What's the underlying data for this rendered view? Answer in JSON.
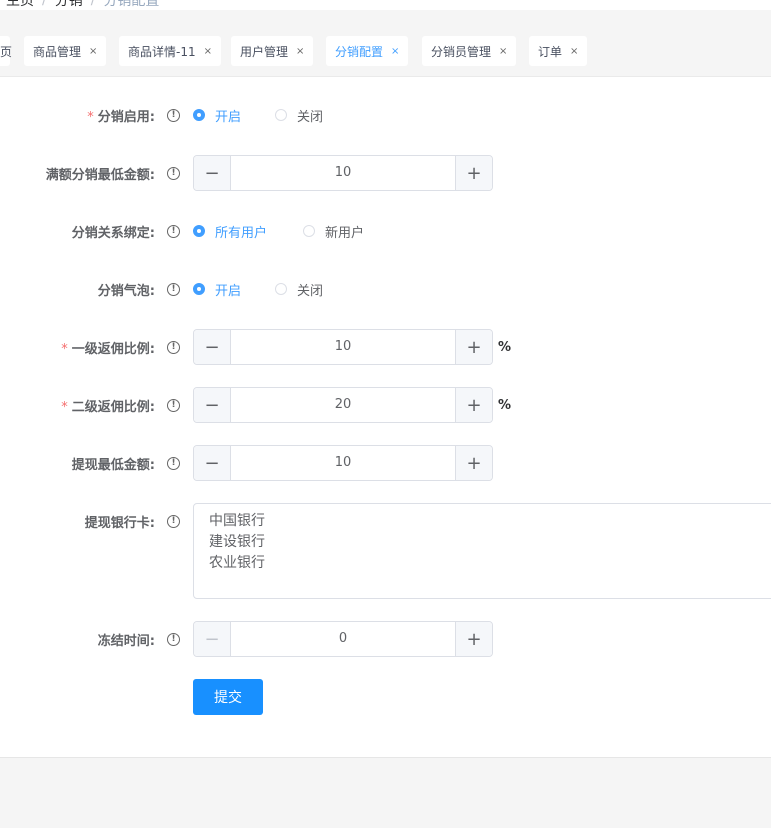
{
  "breadcrumb": {
    "items": [
      "主页",
      "分销",
      "分销配置"
    ],
    "separator": "/"
  },
  "tags": [
    {
      "label": "页",
      "closable": false
    },
    {
      "label": "商品管理",
      "closable": true
    },
    {
      "label": "商品详情-11",
      "closable": true
    },
    {
      "label": "用户管理",
      "closable": true
    },
    {
      "label": "分销配置",
      "closable": true,
      "active": true
    },
    {
      "label": "分销员管理",
      "closable": true
    },
    {
      "label": "订单",
      "closable": true
    }
  ],
  "close_glyph": "×",
  "info_glyph": "!",
  "form": {
    "enable": {
      "label": "分销启用:",
      "required": true,
      "options": [
        "开启",
        "关闭"
      ],
      "selected": "开启"
    },
    "min_amount": {
      "label": "满额分销最低金额:",
      "value": "10"
    },
    "binding": {
      "label": "分销关系绑定:",
      "options": [
        "所有用户",
        "新用户"
      ],
      "selected": "所有用户"
    },
    "bubble": {
      "label": "分销气泡:",
      "options": [
        "开启",
        "关闭"
      ],
      "selected": "开启"
    },
    "level1": {
      "label": "一级返佣比例:",
      "required": true,
      "value": "10",
      "unit": "%"
    },
    "level2": {
      "label": "二级返佣比例:",
      "required": true,
      "value": "20",
      "unit": "%"
    },
    "withdraw_min": {
      "label": "提现最低金额:",
      "value": "10"
    },
    "bank_cards": {
      "label": "提现银行卡:",
      "lines": [
        "中国银行",
        "建设银行",
        "农业银行"
      ]
    },
    "freeze_time": {
      "label": "冻结时间:",
      "value": "0"
    },
    "submit_label": "提交",
    "minus_glyph": "−",
    "plus_glyph": "+",
    "required_mark": "*"
  },
  "colors": {
    "accent": "#409eff",
    "submit": "#1890ff",
    "required": "#f56c6c"
  }
}
